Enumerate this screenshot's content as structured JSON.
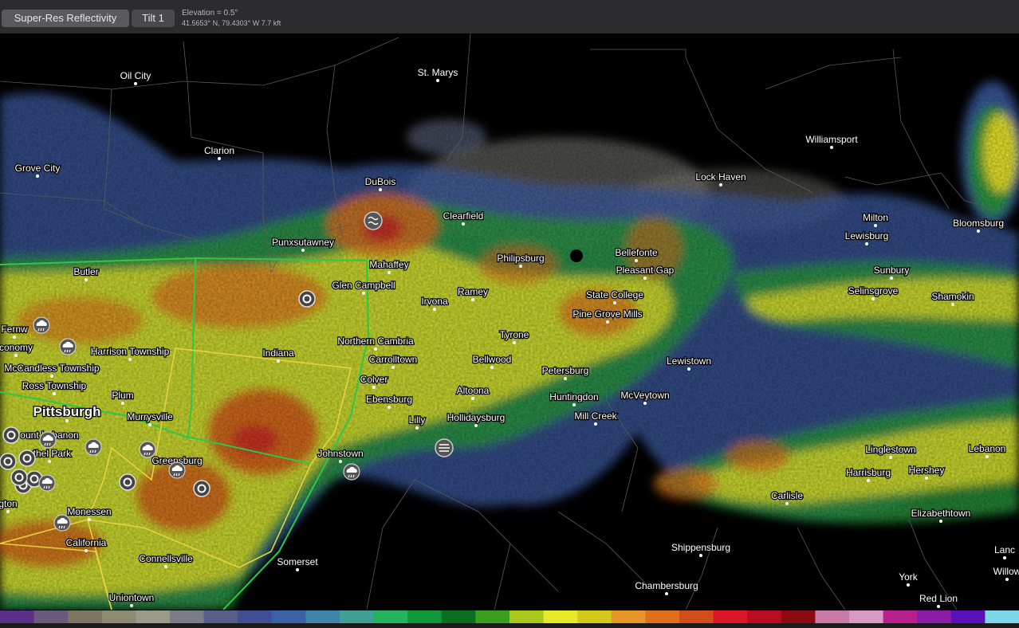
{
  "toolbar": {
    "product_label": "Super-Res Reflectivity",
    "tilt_label": "Tilt 1",
    "elevation": "Elevation = 0.5°",
    "coordinates": "41.5653° N, 79.4303° W 7.7 kft"
  },
  "cities": [
    "Oil City",
    "St. Marys",
    "Clarion",
    "Williamsport",
    "Grove City",
    "DuBois",
    "Lock Haven",
    "Clearfield",
    "Milton",
    "Bloomsburg",
    "Lewisburg",
    "Punxsutawney",
    "Mahaffey",
    "Philipsburg",
    "Bellefonte",
    "Butler",
    "Pleasant Gap",
    "Glen Campbell",
    "Sunbury",
    "Irvona",
    "Ramey",
    "Selinsgrove",
    "State College",
    "Shamokin",
    "Pine Grove Mills",
    "Fernw",
    "conomy",
    "Harrison Township",
    "Northern Cambria",
    "Tyrone",
    "Indiana",
    "Carrolltown",
    "McCandless Township",
    "Bellwood",
    "Lewistown",
    "Colver",
    "Petersburg",
    "Ross Township",
    "Plum",
    "Ebensburg",
    "Altoona",
    "Huntingdon",
    "McVeytown",
    "Pittsburgh",
    "Murrysville",
    "Lilly",
    "Hollidaysburg",
    "Mill Creek",
    "ount Lebanon",
    "ethel Park",
    "Greensburg",
    "Johnstown",
    "Linglestown",
    "Lebanon",
    "Hershey",
    "Harrisburg",
    "Carlisle",
    "Monessen",
    "gton",
    "Elizabethtown",
    "California",
    "Connellsville",
    "Shippensburg",
    "Somerset",
    "Lanc",
    "Willow",
    "York",
    "Chambersburg",
    "Uniontown",
    "Red Lion"
  ],
  "legend": {
    "colors": [
      "#5c2f8a",
      "#6a5a7e",
      "#7e7462",
      "#8d8a74",
      "#9a9a8a",
      "#7c7c88",
      "#5a5e8a",
      "#3f4e95",
      "#3b62a6",
      "#3f83a8",
      "#3fa095",
      "#25b25a",
      "#12963a",
      "#0b6f22",
      "#3aa01c",
      "#a8c81e",
      "#e6e82a",
      "#d4c81a",
      "#e8962a",
      "#e06e1e",
      "#d24e18",
      "#dc1428",
      "#b80c20",
      "#8c0a12",
      "#c87aa4",
      "#d69ac4",
      "#b8208e",
      "#8a1ca8",
      "#5a12b8",
      "#7ad8e8"
    ]
  },
  "icons": {
    "warning_storm": "storm-cell-icon",
    "hail": "hail-icon",
    "rain": "rain-cloud-icon",
    "fog": "fog-icon",
    "radar_site": "radar-site-icon"
  }
}
